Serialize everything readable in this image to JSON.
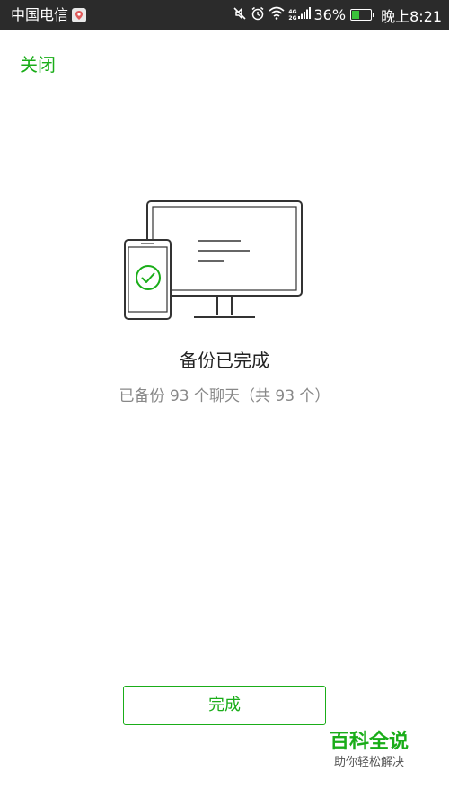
{
  "status_bar": {
    "carrier": "中国电信",
    "battery_percent": "36%",
    "battery_level": 0.36,
    "time": "晚上8:21",
    "network_top": "4G",
    "network_bottom": "2G",
    "icons": [
      "notification-app-icon",
      "mute-icon",
      "alarm-icon",
      "wifi-icon",
      "signal-icon",
      "battery-icon"
    ]
  },
  "header": {
    "close_label": "关闭"
  },
  "main": {
    "title": "备份已完成",
    "subtitle": "已备份 93 个聊天（共 93 个）"
  },
  "actions": {
    "done_label": "完成"
  },
  "watermark": {
    "title": "百科全说",
    "subtitle": "助你轻松解决"
  },
  "colors": {
    "accent": "#1aad19",
    "status_bar_bg": "#2b2b2b",
    "text_primary": "#222222",
    "text_secondary": "#888888",
    "illustration_stroke": "#333333"
  }
}
